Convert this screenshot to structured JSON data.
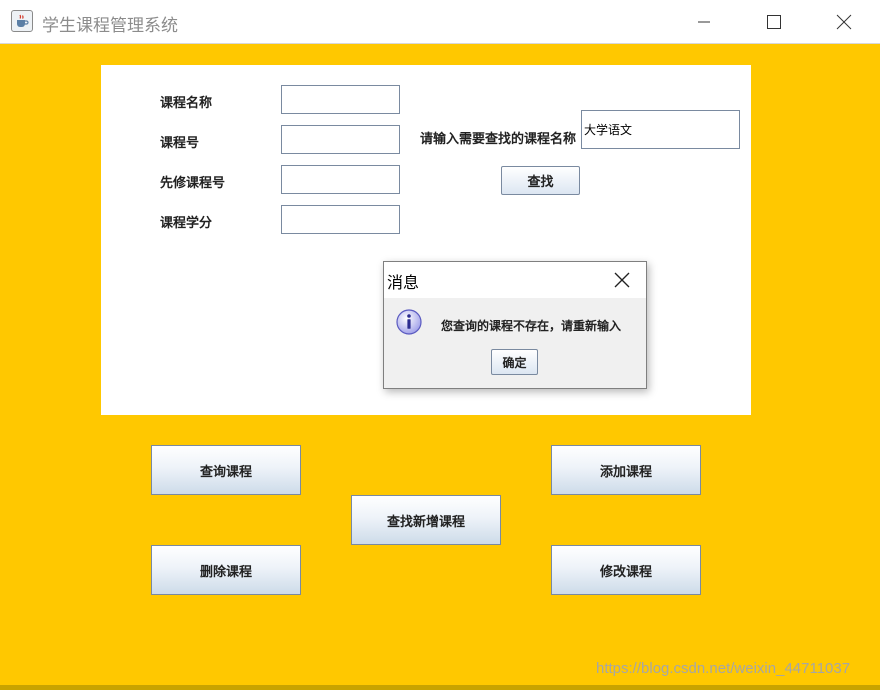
{
  "window": {
    "title": "学生课程管理系统",
    "icon": "java-coffee-cup-icon"
  },
  "form": {
    "course_name_label": "课程名称",
    "course_no_label": "课程号",
    "prereq_label": "先修课程号",
    "credit_label": "课程学分",
    "course_name_value": "",
    "course_no_value": "",
    "prereq_value": "",
    "credit_value": ""
  },
  "search": {
    "label": "请输入需要查找的课程名称",
    "value": "大学语文",
    "button": "查找"
  },
  "dialog": {
    "title": "消息",
    "message": "您查询的课程不存在，请重新输入",
    "ok": "确定",
    "icon": "info-icon"
  },
  "actions": {
    "query": "查询课程",
    "add": "添加课程",
    "find_new": "查找新增课程",
    "delete": "删除课程",
    "modify": "修改课程"
  },
  "watermark": "https://blog.csdn.net/weixin_44711037",
  "colors": {
    "background": "#ffc800",
    "panel": "#ffffff",
    "dialog_bg": "#f0f0f0"
  }
}
